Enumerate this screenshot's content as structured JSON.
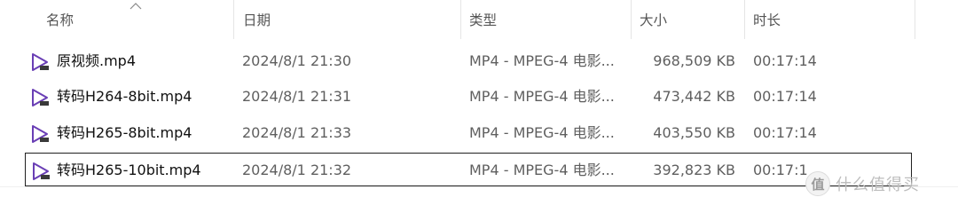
{
  "columns": {
    "name": "名称",
    "date": "日期",
    "type": "类型",
    "size": "大小",
    "duration": "时长"
  },
  "files": [
    {
      "name": "原视频.mp4",
      "date": "2024/8/1 21:30",
      "type": "MP4 - MPEG-4 电影...",
      "size": "968,509 KB",
      "duration": "00:17:14"
    },
    {
      "name": "转码H264-8bit.mp4",
      "date": "2024/8/1 21:31",
      "type": "MP4 - MPEG-4 电影...",
      "size": "473,442 KB",
      "duration": "00:17:14"
    },
    {
      "name": "转码H265-8bit.mp4",
      "date": "2024/8/1 21:33",
      "type": "MP4 - MPEG-4 电影...",
      "size": "403,550 KB",
      "duration": "00:17:14"
    },
    {
      "name": "转码H265-10bit.mp4",
      "date": "2024/8/1 21:32",
      "type": "MP4 - MPEG-4 电影...",
      "size": "392,823 KB",
      "duration": "00:17:1"
    }
  ],
  "watermark": {
    "logo": "值",
    "text": "什么值得买"
  },
  "colors": {
    "icon_accent": "#6a3fb5",
    "focus_border": "#202020"
  }
}
